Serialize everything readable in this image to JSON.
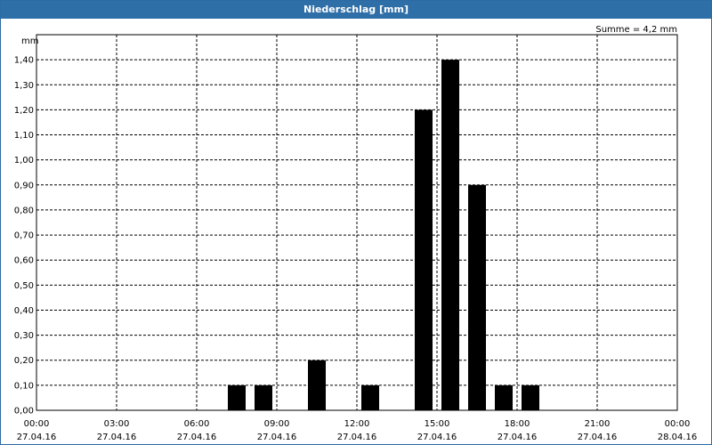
{
  "window": {
    "title": "Niederschlag [mm]"
  },
  "colors": {
    "title_bar": "#2f6fa8",
    "bar": "#000000",
    "grid": "#000000"
  },
  "chart_data": {
    "type": "bar",
    "title": "Niederschlag [mm]",
    "ylabel": "mm",
    "annotation": "Summe = 4,2 mm",
    "ylim": [
      0,
      1.5
    ],
    "xlim_hours": [
      0,
      24
    ],
    "y_ticks": [
      "0,00",
      "0,10",
      "0,20",
      "0,30",
      "0,40",
      "0,50",
      "0,60",
      "0,70",
      "0,80",
      "0,90",
      "1,00",
      "1,10",
      "1,20",
      "1,30",
      "1,40"
    ],
    "x_ticks": [
      {
        "time": "00:00",
        "date": "27.04.16"
      },
      {
        "time": "03:00",
        "date": "27.04.16"
      },
      {
        "time": "06:00",
        "date": "27.04.16"
      },
      {
        "time": "09:00",
        "date": "27.04.16"
      },
      {
        "time": "12:00",
        "date": "27.04.16"
      },
      {
        "time": "15:00",
        "date": "27.04.16"
      },
      {
        "time": "18:00",
        "date": "27.04.16"
      },
      {
        "time": "21:00",
        "date": "27.04.16"
      },
      {
        "time": "00:00",
        "date": "28.04.16"
      }
    ],
    "bars": [
      {
        "hour": 7,
        "value": 0.1
      },
      {
        "hour": 8,
        "value": 0.1
      },
      {
        "hour": 10,
        "value": 0.2
      },
      {
        "hour": 12,
        "value": 0.1
      },
      {
        "hour": 14,
        "value": 1.2
      },
      {
        "hour": 15,
        "value": 1.4
      },
      {
        "hour": 16,
        "value": 0.9
      },
      {
        "hour": 17,
        "value": 0.1
      },
      {
        "hour": 18,
        "value": 0.1
      }
    ],
    "grid": true,
    "legend": "none"
  }
}
